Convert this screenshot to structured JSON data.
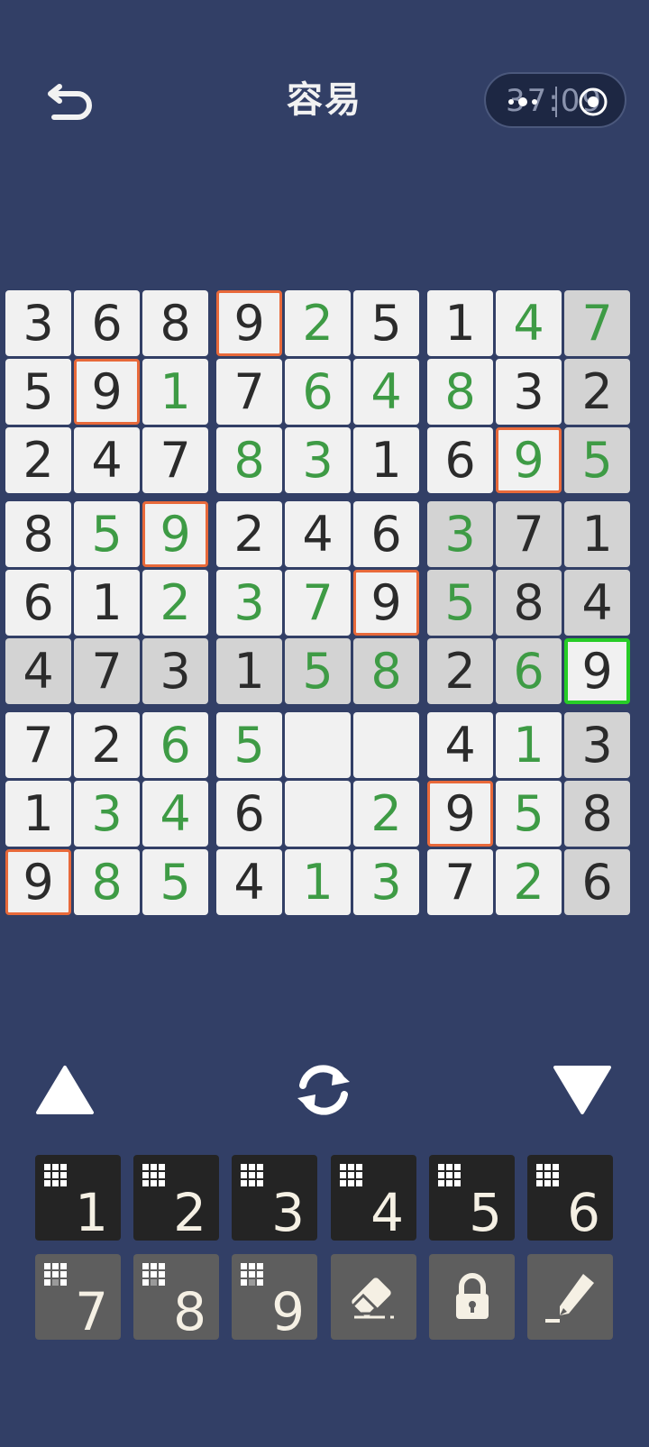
{
  "header": {
    "title": "容易",
    "timer": "37:09"
  },
  "board": {
    "rows": [
      [
        3,
        6,
        8,
        9,
        2,
        5,
        1,
        4,
        7
      ],
      [
        5,
        9,
        1,
        7,
        6,
        4,
        8,
        3,
        2
      ],
      [
        2,
        4,
        7,
        8,
        3,
        1,
        6,
        9,
        5
      ],
      [
        8,
        5,
        9,
        2,
        4,
        6,
        3,
        7,
        1
      ],
      [
        6,
        1,
        2,
        3,
        7,
        9,
        5,
        8,
        4
      ],
      [
        4,
        7,
        3,
        1,
        5,
        8,
        2,
        6,
        9
      ],
      [
        7,
        2,
        6,
        5,
        null,
        null,
        4,
        1,
        3
      ],
      [
        1,
        3,
        4,
        6,
        null,
        2,
        9,
        5,
        8
      ],
      [
        9,
        8,
        5,
        4,
        1,
        3,
        7,
        2,
        6
      ]
    ],
    "entered_mask": [
      "000010011",
      "001011100",
      "000110011",
      "011000100",
      "001110100",
      "000011010",
      "001100010",
      "011001010",
      "011011010"
    ],
    "selected": [
      5,
      8
    ],
    "colors": {
      "given": "#2b2b2b",
      "entered": "#3e9b45",
      "same_number_outline": "#e8693a",
      "selected_outline": "#27cc27",
      "highlight_bg": "#d3d3d3",
      "cell_bg": "#f1f1f1",
      "page_bg": "#323f66"
    }
  },
  "controls": {
    "up": "triangle-up-icon",
    "refresh": "refresh-icon",
    "down": "triangle-down-icon"
  },
  "keypad": {
    "numbers": [
      {
        "label": "1",
        "style": "dark"
      },
      {
        "label": "2",
        "style": "dark"
      },
      {
        "label": "3",
        "style": "dark"
      },
      {
        "label": "4",
        "style": "dark"
      },
      {
        "label": "5",
        "style": "dark"
      },
      {
        "label": "6",
        "style": "dark"
      },
      {
        "label": "7",
        "style": "gray"
      },
      {
        "label": "8",
        "style": "gray"
      },
      {
        "label": "9",
        "style": "gray"
      }
    ],
    "tools": [
      "eraser-icon",
      "lock-icon",
      "pencil-icon"
    ]
  }
}
